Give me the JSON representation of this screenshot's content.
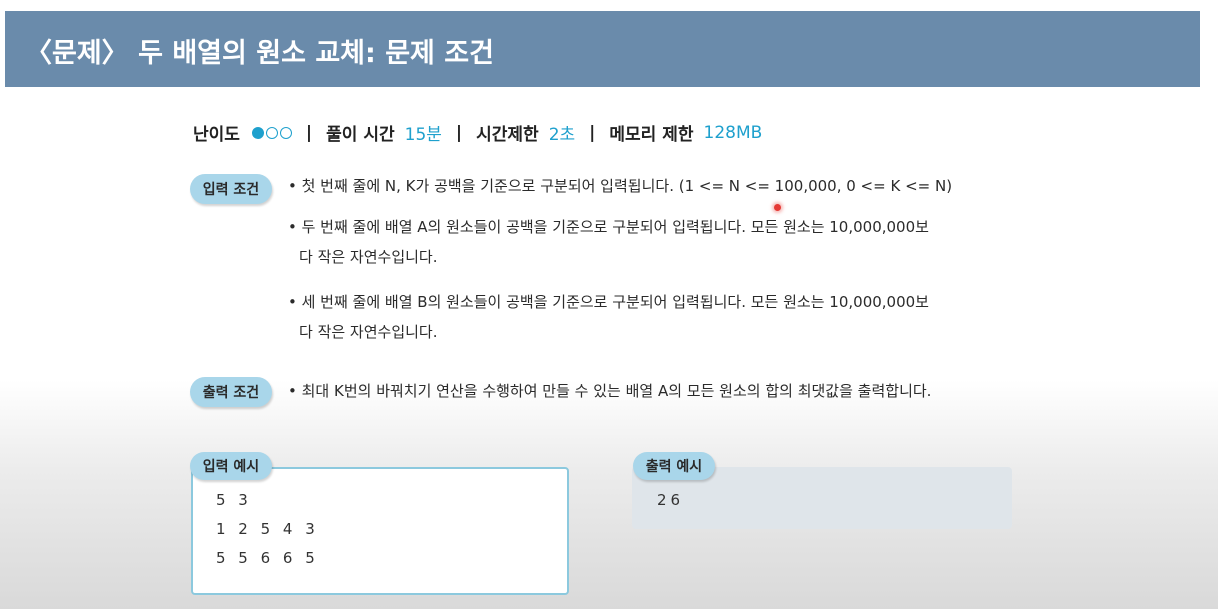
{
  "header": {
    "title": "〈문제〉 두 배열의 원소 교체: 문제 조건"
  },
  "meta": {
    "difficulty_label": "난이도",
    "difficulty_level": 1,
    "difficulty_max": 3,
    "separator": "|",
    "solve_time_label": "풀이 시간",
    "solve_time_value": "15분",
    "time_limit_label": "시간제한",
    "time_limit_value": "2초",
    "memory_limit_label": "메모리 제한",
    "memory_limit_value": "128MB"
  },
  "input_conditions": {
    "badge": "입력 조건",
    "bullets": [
      {
        "line1": "• 첫 번째 줄에 N, K가 공백을 기준으로 구분되어 입력됩니다. (1 <= N <= 100,000, 0 <= K <= N)"
      },
      {
        "line1": "• 두 번째 줄에 배열 A의 원소들이 공백을 기준으로 구분되어 입력됩니다. 모든 원소는 10,000,000보",
        "line2": "다 작은 자연수입니다."
      },
      {
        "line1": "• 세 번째 줄에 배열 B의 원소들이 공백을 기준으로 구분되어 입력됩니다. 모든 원소는 10,000,000보",
        "line2": "다 작은 자연수입니다."
      }
    ]
  },
  "output_conditions": {
    "badge": "출력 조건",
    "bullet": "• 최대 K번의 바꿔치기 연산을 수행하여 만들 수 있는 배열 A의 모든 원소의 합의 최댓값을 출력합니다."
  },
  "input_example": {
    "badge": "입력 예시",
    "lines": [
      "5 3",
      "1 2 5 4 3",
      "5 5 6 6 5"
    ]
  },
  "output_example": {
    "badge": "출력 예시",
    "lines": [
      "26"
    ]
  },
  "colors": {
    "header_bg": "#6a8bab",
    "accent": "#1ea0cd",
    "badge_bg": "#a9d6ea"
  }
}
